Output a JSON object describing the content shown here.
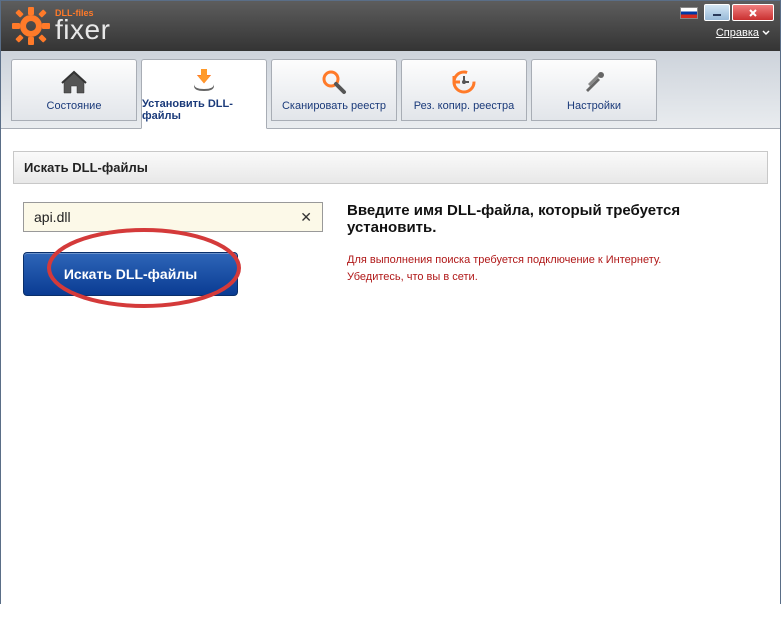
{
  "app": {
    "brand_sub": "DLL-files",
    "brand_main": "fixer"
  },
  "titlebar": {
    "help_link": "Справка"
  },
  "tabs": [
    {
      "label": "Состояние"
    },
    {
      "label": "Установить DLL-файлы"
    },
    {
      "label": "Сканировать реестр"
    },
    {
      "label": "Рез. копир. реестра"
    },
    {
      "label": "Настройки"
    }
  ],
  "section": {
    "title": "Искать DLL-файлы"
  },
  "search": {
    "value": "api.dll",
    "button": "Искать DLL-файлы"
  },
  "info": {
    "headline": "Введите имя DLL-файла, который требуется установить.",
    "warning_line1": "Для выполнения поиска требуется подключение к Интернету.",
    "warning_line2": "Убедитесь, что вы в сети."
  }
}
